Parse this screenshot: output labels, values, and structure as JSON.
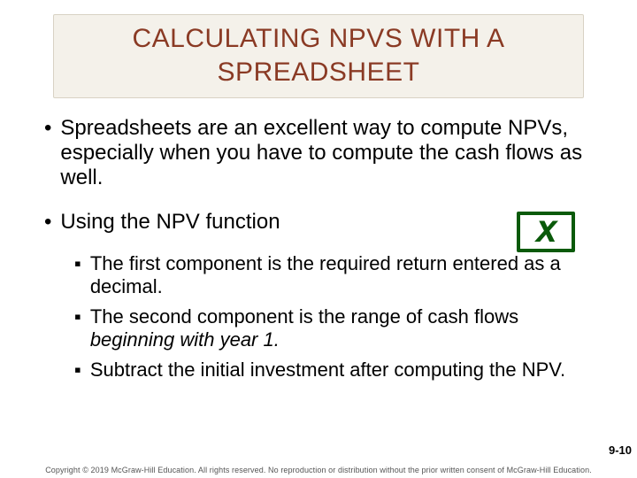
{
  "title": "CALCULATING NPVS WITH A SPREADSHEET",
  "bullets": {
    "b1": "Spreadsheets are an excellent way to compute NPVs, especially when you have to compute the cash flows as well.",
    "b2": "Using the NPV function"
  },
  "sub": {
    "s1": "The first component is the required return entered as a decimal.",
    "s2_a": "The second component is the range of cash flows ",
    "s2_b": "beginning with year 1.",
    "s3": "Subtract the initial investment after computing the NPV."
  },
  "page": "9-10",
  "copyright": "Copyright © 2019 McGraw-Hill Education. All rights reserved. No reproduction or distribution without the prior written consent of McGraw-Hill Education."
}
